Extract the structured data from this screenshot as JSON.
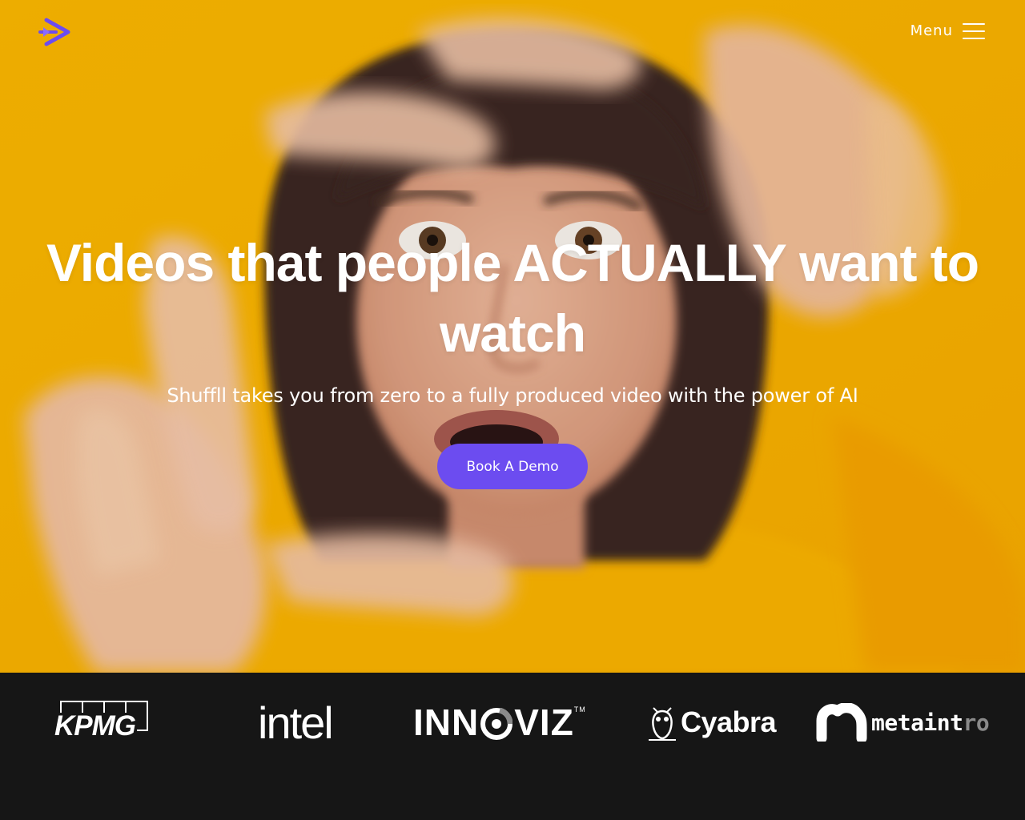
{
  "brand": {
    "accent": "#6c4cf0",
    "hero_bg": "#f5b100",
    "strip_bg": "#161616",
    "logo_icon": "play-arrow-logo-icon"
  },
  "nav": {
    "menu_label": "Menu",
    "menu_icon": "hamburger-icon"
  },
  "hero": {
    "headline": "Videos that people ACTUALLY want to watch",
    "subline": "Shuffll takes you from zero to a fully produced video with the power of AI",
    "cta_label": "Book A Demo"
  },
  "clients": {
    "kpmg": "KPMG",
    "intel": "intel",
    "innoviz_before": "INN",
    "innoviz_after": "VIZ",
    "innoviz_tm": "TM",
    "cyabra": "Cyabra",
    "metaintro_main": "metaint",
    "metaintro_tail": "ro"
  }
}
